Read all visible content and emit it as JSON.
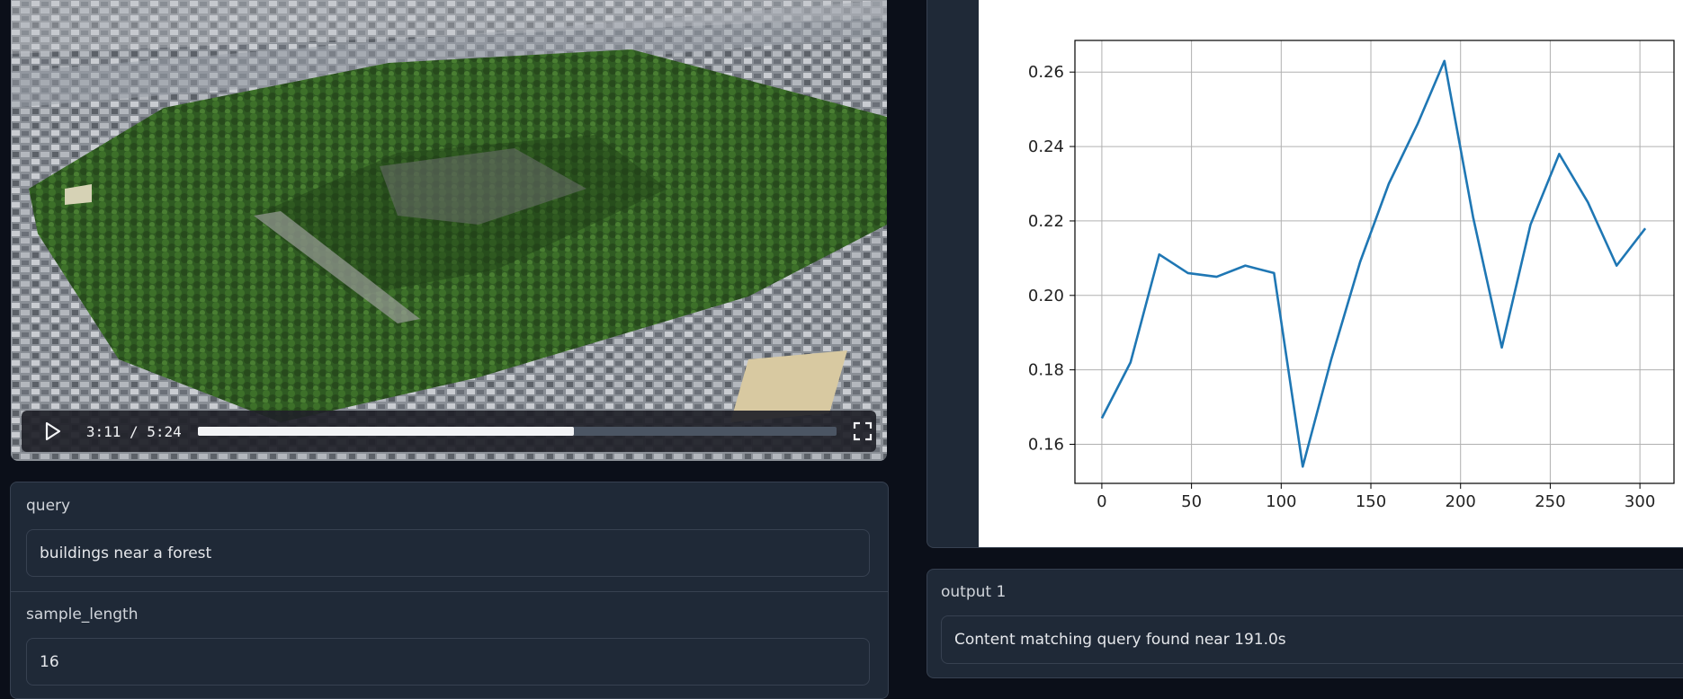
{
  "video": {
    "current_time": "3:11",
    "duration": "5:24",
    "time_display": "3:11 / 5:24",
    "progress_fraction": 0.589,
    "play_icon": "play-icon",
    "fullscreen_icon": "fullscreen-icon"
  },
  "inputs": {
    "query": {
      "label": "query",
      "value": "buildings near a forest"
    },
    "sample_length": {
      "label": "sample_length",
      "value": "16"
    }
  },
  "output": {
    "label": "output 1",
    "text": "Content matching query found near 191.0s"
  },
  "colors": {
    "background": "#0b0f19",
    "panel": "#1f2937",
    "border": "#374151",
    "line": "#1f77b4"
  },
  "chart_data": {
    "type": "line",
    "title": "",
    "xlabel": "",
    "ylabel": "",
    "x": [
      0,
      16,
      32,
      48,
      64,
      80,
      96,
      112,
      128,
      144,
      160,
      176,
      191,
      207,
      223,
      239,
      255,
      271,
      287,
      303
    ],
    "series": [
      {
        "values": [
          0.167,
          0.182,
          0.211,
          0.206,
          0.205,
          0.208,
          0.206,
          0.154,
          0.183,
          0.209,
          0.23,
          0.246,
          0.263,
          0.221,
          0.186,
          0.219,
          0.238,
          0.225,
          0.208,
          0.218
        ]
      }
    ],
    "xlim": [
      -15,
      319
    ],
    "ylim": [
      0.1495,
      0.2685
    ],
    "xticks": [
      "0",
      "50",
      "100",
      "150",
      "200",
      "250",
      "300"
    ],
    "yticks": [
      "0.16",
      "0.18",
      "0.20",
      "0.22",
      "0.24",
      "0.26"
    ],
    "grid": true
  }
}
